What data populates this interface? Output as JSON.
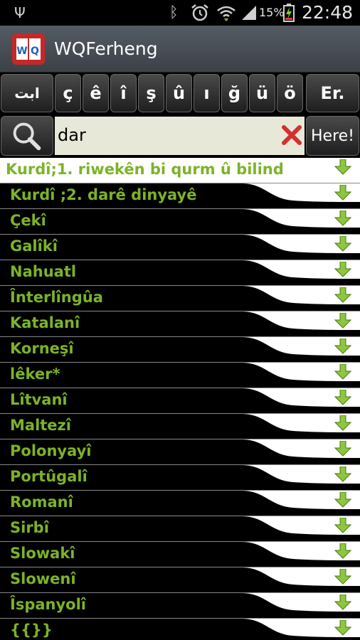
{
  "status": {
    "battery_percent": "15%",
    "time": "22:48"
  },
  "app": {
    "title": "WQFerheng"
  },
  "keys": {
    "arabic": "ابت",
    "chars": [
      "ç",
      "ê",
      "î",
      "ş",
      "û",
      "ı",
      "ğ",
      "ü",
      "ö"
    ],
    "er": "Er."
  },
  "search": {
    "value": "dar",
    "here_label": "Here!"
  },
  "results": [
    " Kurdî;1. riwekên bi qurm û bilind",
    "Kurdî ;2. darê dinyayê",
    "Çekî",
    "Galîkî",
    "Nahuatl",
    "Înterlîngûa",
    "Katalanî",
    "Korneşî",
    "lêker*",
    "Lîtvanî",
    "Maltezî",
    "Polonyayî",
    "Portûgalî",
    "Romanî",
    "Sirbî",
    "Slowakî",
    "Slowenî",
    "Îspanyolî",
    "{{}}"
  ],
  "colors": {
    "label_green": "#7cb328",
    "arrow_green": "#8dc63f"
  }
}
